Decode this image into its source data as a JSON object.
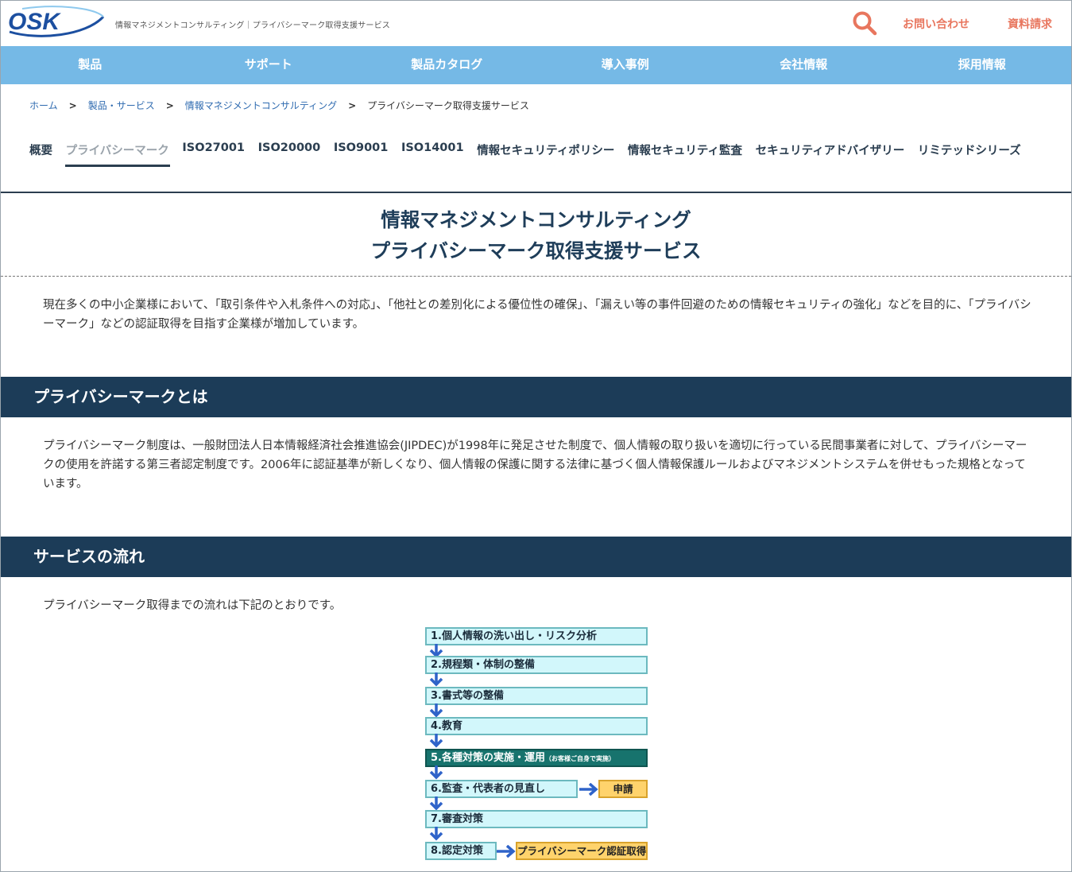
{
  "header": {
    "logo_text": "OSK",
    "tagline": "情報マネジメントコンサルティング｜プライバシーマーク取得支援サービス",
    "contact": "お問い合わせ",
    "docs": "資料請求"
  },
  "nav": {
    "items": [
      {
        "label": "製品"
      },
      {
        "label": "サポート"
      },
      {
        "label": "製品カタログ"
      },
      {
        "label": "導入事例"
      },
      {
        "label": "会社情報"
      },
      {
        "label": "採用情報"
      }
    ]
  },
  "breadcrumb": [
    {
      "label": "ホーム"
    },
    {
      "label": "製品・サービス"
    },
    {
      "label": "情報マネジメントコンサルティング"
    },
    {
      "label": "プライバシーマーク取得支援サービス"
    }
  ],
  "subtabs": [
    {
      "label": "概要"
    },
    {
      "label": "プライバシーマーク"
    },
    {
      "label": "ISO27001"
    },
    {
      "label": "ISO20000"
    },
    {
      "label": "ISO9001"
    },
    {
      "label": "ISO14001"
    },
    {
      "label": "情報セキュリティポリシー"
    },
    {
      "label": "情報セキュリティ監査"
    },
    {
      "label": "セキュリティアドバイザリー"
    },
    {
      "label": "リミテッドシリーズ"
    }
  ],
  "title": {
    "line1": "情報マネジメントコンサルティング",
    "line2": "プライバシーマーク取得支援サービス"
  },
  "intro": "現在多くの中小企業様において、「取引条件や入札条件への対応」、「他社との差別化による優位性の確保」、「漏えい等の事件回避のための情報セキュリティの強化」などを目的に、「プライバシーマーク」などの認証取得を目指す企業様が増加しています。",
  "section1": {
    "heading": "プライバシーマークとは",
    "body": "プライバシーマーク制度は、一般財団法人日本情報経済社会推進協会(JIPDEC)が1998年に発足させた制度で、個人情報の取り扱いを適切に行っている民間事業者に対して、プライバシーマークの使用を許諾する第三者認定制度です。2006年に認証基準が新しくなり、個人情報の保護に関する法律に基づく個人情報保護ルールおよびマネジメントシステムを併せもった規格となっています。"
  },
  "section2": {
    "heading": "サービスの流れ",
    "body": "プライバシーマーク取得までの流れは下記のとおりです。"
  },
  "flow": {
    "steps": [
      {
        "label": "1.個人情報の洗い出し・リスク分析"
      },
      {
        "label": "2.規程類・体制の整備"
      },
      {
        "label": "3.書式等の整備"
      },
      {
        "label": "4.教育"
      },
      {
        "label": "5.各種対策の実施・運用",
        "note": "（お客様ご自身で実施）"
      },
      {
        "label": "6.監査・代表者の見直し"
      },
      {
        "label": "7.審査対策"
      },
      {
        "label": "8.認定対策"
      }
    ],
    "apply": "申請",
    "obtain": "プライバシーマーク認証取得"
  },
  "colors": {
    "nav_bg": "#75b9e6",
    "section_bg": "#1c3c58",
    "accent": "#e8765e",
    "title": "#1e3d59"
  }
}
